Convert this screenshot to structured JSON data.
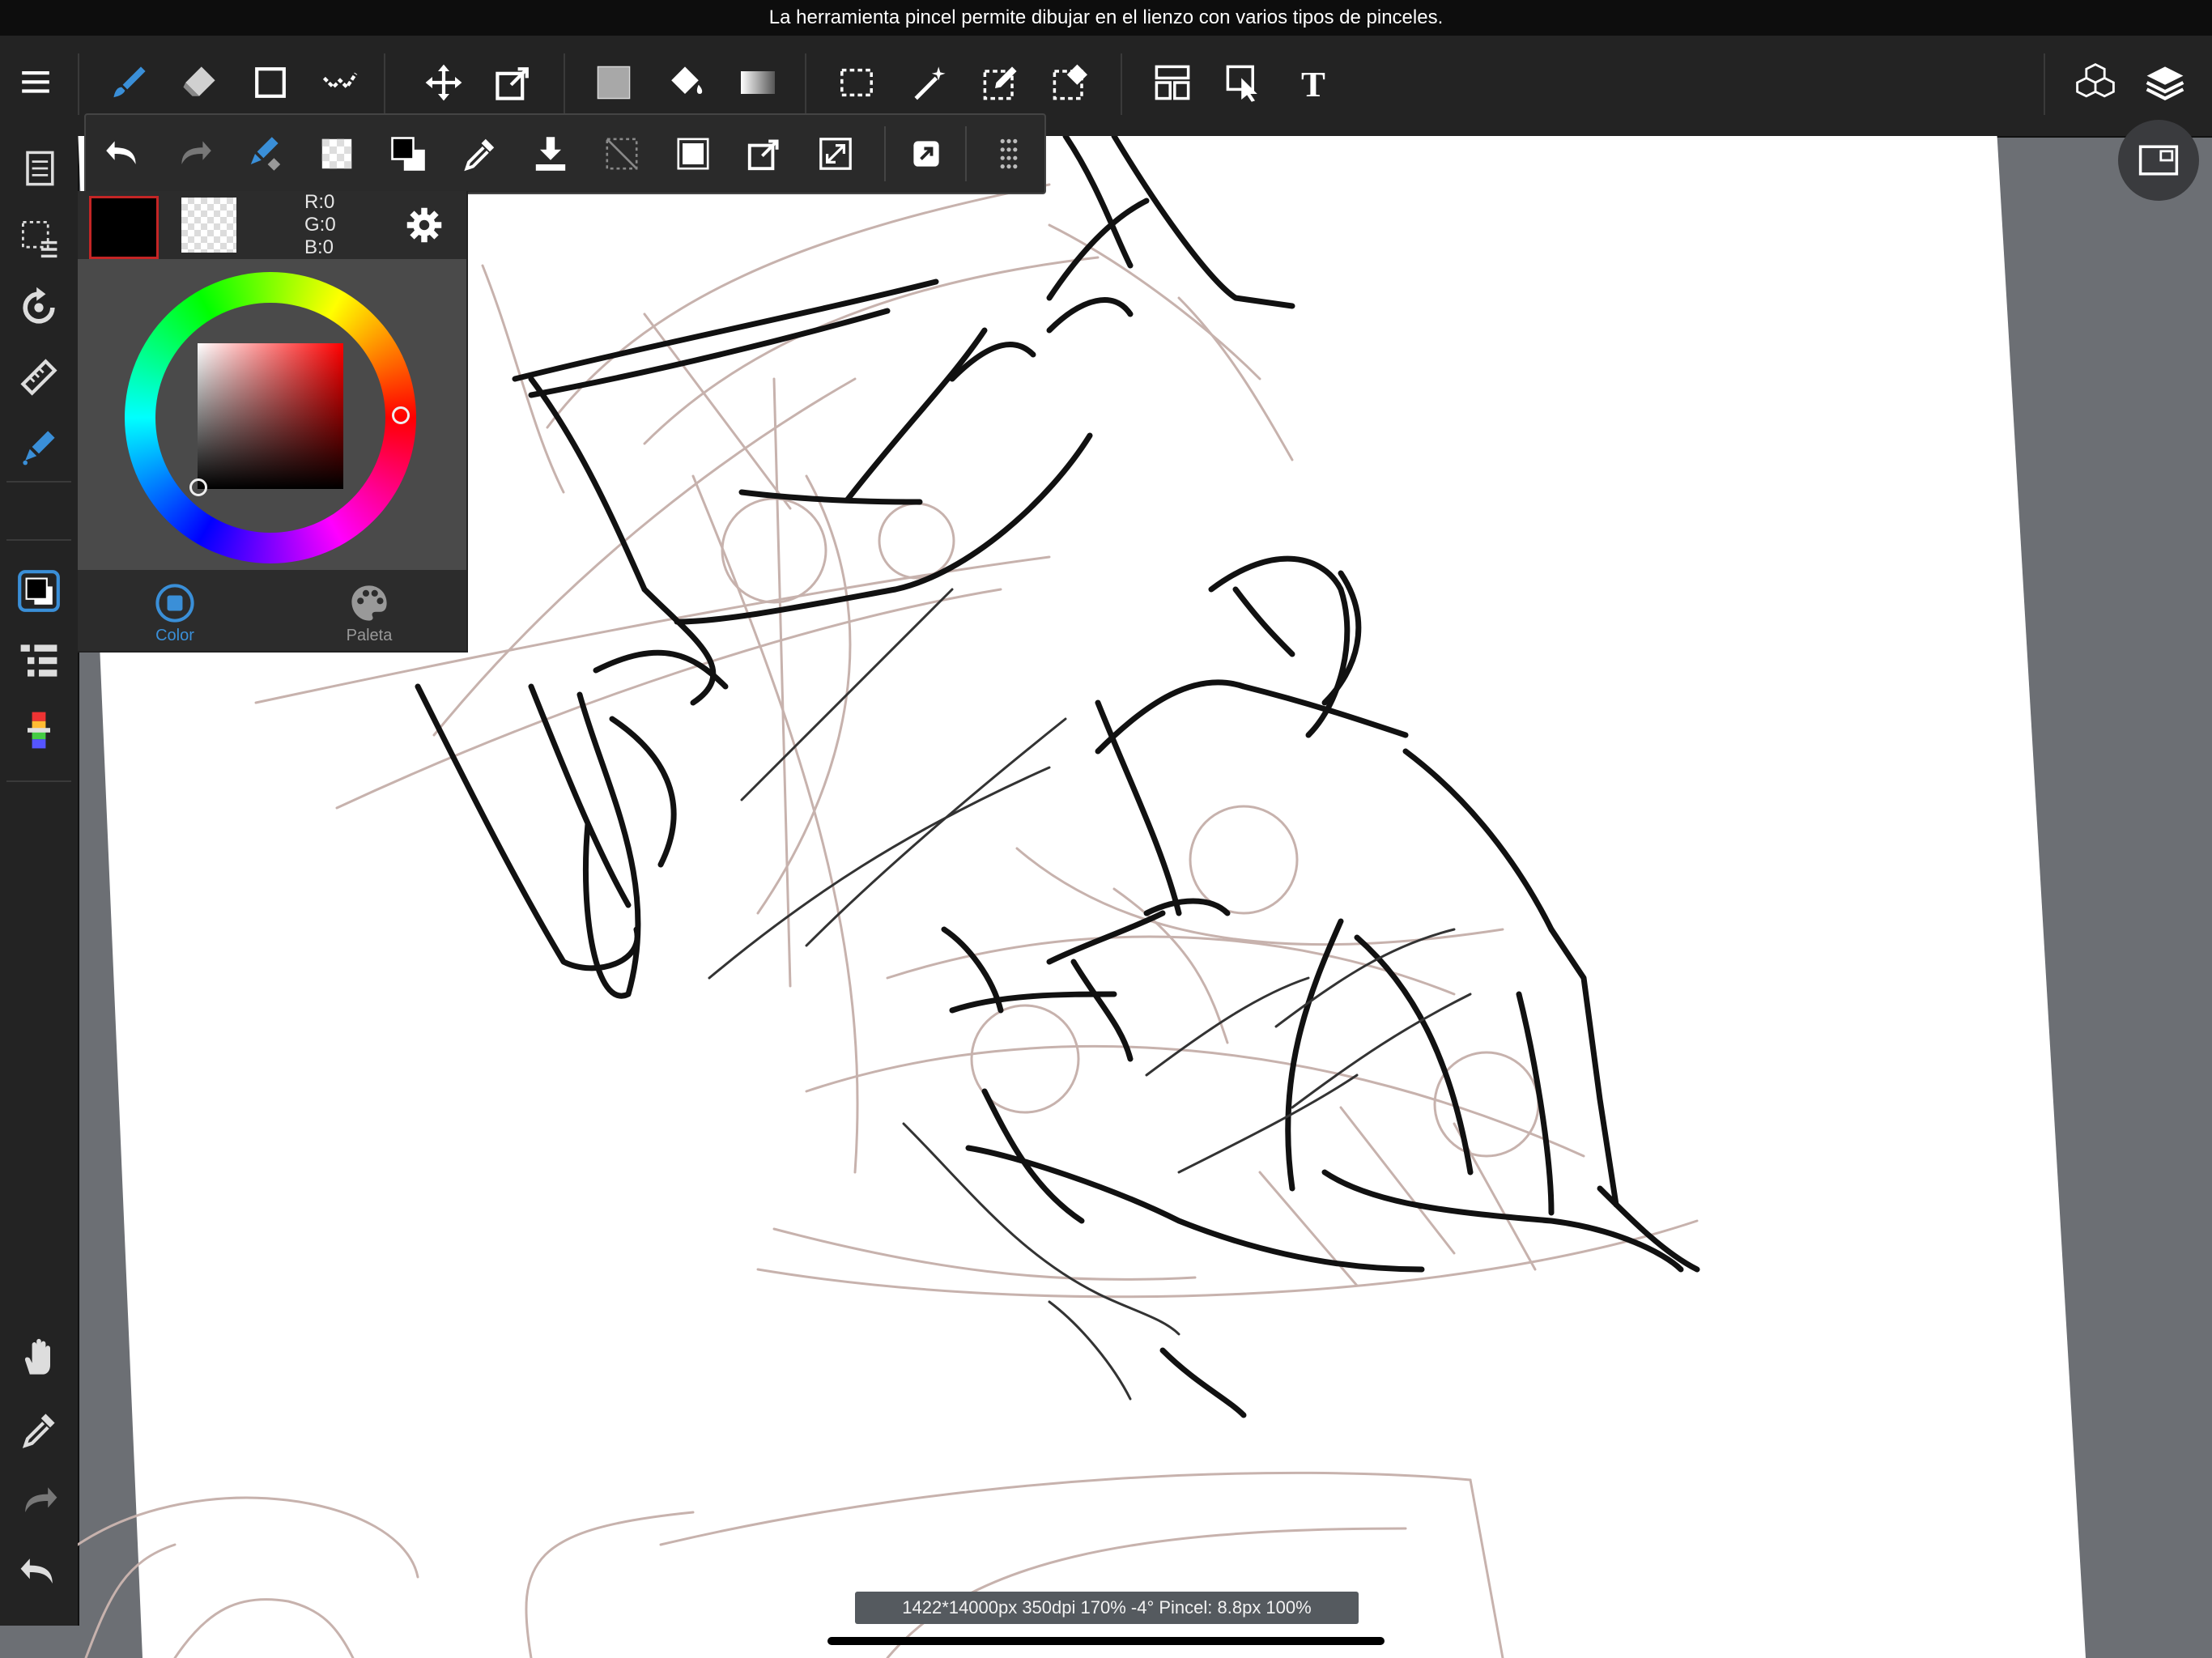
{
  "hint_bar": {
    "text": "La herramienta pincel permite dibujar en el lienzo con varios tipos de pinceles."
  },
  "toolbar": {
    "items": [
      "menu-icon",
      "brush-icon",
      "eraser-icon",
      "shape-icon",
      "dot-tool-icon",
      "move-icon",
      "transform-icon",
      "fill-color-icon",
      "bucket-icon",
      "gradient-icon",
      "select-rect-icon",
      "magic-wand-icon",
      "select-pen-icon",
      "select-eraser-icon",
      "panel-layout-icon",
      "select-object-icon",
      "text-icon",
      "3d-model-icon",
      "layers-icon"
    ]
  },
  "color_panel": {
    "fg_color": "#000000",
    "rgb": {
      "r": "R:0",
      "g": "G:0",
      "b": "B:0"
    },
    "tabs": {
      "color": "Color",
      "palette": "Paleta"
    },
    "active_tab": "Color"
  },
  "status": {
    "text": "1422*14000px 350dpi 170% -4° Pincel: 8.8px 100%"
  },
  "colors": {
    "chrome": "#232323",
    "accent": "#3a8fd8",
    "sketch_light": "#c7b2ad",
    "sketch_dark": "#111111"
  }
}
